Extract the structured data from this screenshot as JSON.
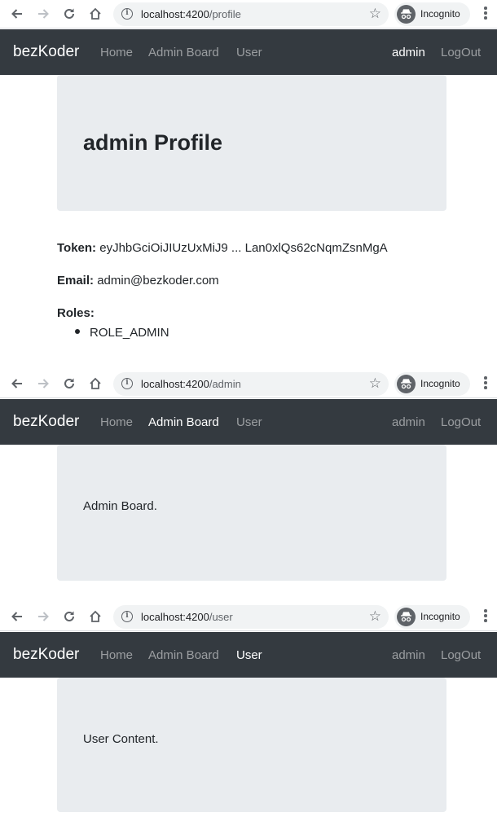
{
  "browser": {
    "incognito_label": "Incognito"
  },
  "app": {
    "brand": "bezKoder",
    "nav": {
      "home": "Home",
      "admin_board": "Admin Board",
      "user": "User"
    },
    "username": "admin",
    "logout": "LogOut"
  },
  "profile_page": {
    "url_host": "localhost:4200",
    "url_path": "/profile",
    "heading_user": "admin",
    "heading_suffix": "Profile",
    "token_label": "Token:",
    "token_value": "eyJhbGciOiJIUzUxMiJ9 ... Lan0xlQs62cNqmZsnMgA",
    "email_label": "Email:",
    "email_value": "admin@bezkoder.com",
    "roles_label": "Roles:",
    "roles": [
      "ROLE_ADMIN"
    ]
  },
  "admin_page": {
    "url_host": "localhost:4200",
    "url_path": "/admin",
    "content": "Admin Board."
  },
  "user_page": {
    "url_host": "localhost:4200",
    "url_path": "/user",
    "content": "User Content."
  }
}
